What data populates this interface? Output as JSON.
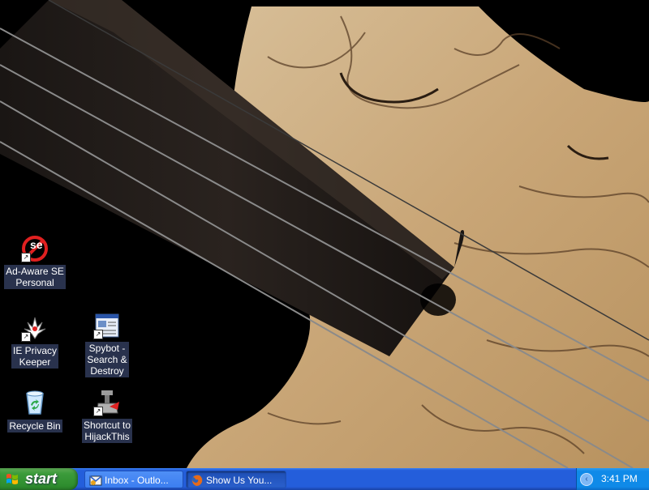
{
  "desktop": {
    "icons": [
      {
        "label": "Ad-Aware SE\nPersonal"
      },
      {
        "label": "IE Privacy\nKeeper"
      },
      {
        "label": "Spybot -\nSearch &\nDestroy"
      },
      {
        "label": "Recycle Bin"
      },
      {
        "label": "Shortcut to\nHijackThis"
      }
    ],
    "ad_aware_badge": "se"
  },
  "taskbar": {
    "start_label": "start",
    "tasks": [
      {
        "label": "Inbox - Outlo...",
        "icon": "outlook-icon"
      },
      {
        "label": "Show Us You...",
        "icon": "firefox-icon"
      }
    ],
    "clock": "3:41 PM",
    "chevron": "‹"
  }
}
